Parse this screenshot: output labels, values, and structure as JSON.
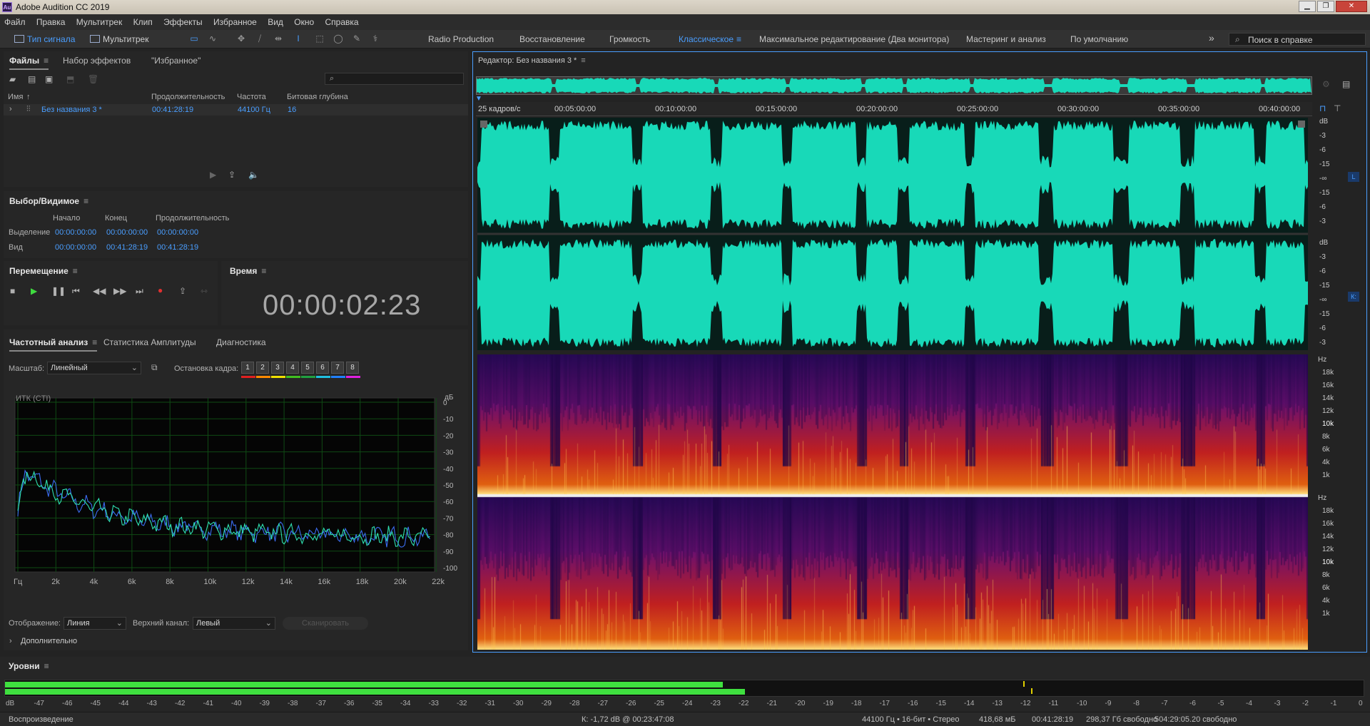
{
  "window": {
    "title": "Adobe Audition CC 2019",
    "logo_text": "Au"
  },
  "menu": [
    "Файл",
    "Правка",
    "Мультитрек",
    "Клип",
    "Эффекты",
    "Избранное",
    "Вид",
    "Окно",
    "Справка"
  ],
  "modes": {
    "waveform": "Тип сигнала",
    "multitrack": "Мультитрек"
  },
  "workspaces": [
    "Radio Production",
    "Восстановление",
    "Громкость",
    "Классическое",
    "Максимальное редактирование (Два монитора)",
    "Мастеринг и анализ",
    "По умолчанию"
  ],
  "active_workspace": "Классическое",
  "help_search_placeholder": "Поиск в справке",
  "files_panel": {
    "tabs": [
      "Файлы",
      "Набор эффектов",
      "\"Избранное\""
    ],
    "columns": [
      "Имя",
      "Продолжительность",
      "Частота",
      "Битовая глубина"
    ],
    "rows": [
      {
        "name": "Без названия 3 *",
        "duration": "00:41:28:19",
        "rate": "44100 Гц",
        "depth": "16"
      }
    ]
  },
  "selection_panel": {
    "title": "Выбор/Видимое",
    "headers": [
      "Начало",
      "Конец",
      "Продолжительность"
    ],
    "rows": [
      {
        "label": "Выделение",
        "start": "00:00:00:00",
        "end": "00:00:00:00",
        "duration": "00:00:00:00"
      },
      {
        "label": "Вид",
        "start": "00:00:00:00",
        "end": "00:41:28:19",
        "duration": "00:41:28:19"
      }
    ]
  },
  "transport_panel": {
    "title": "Перемещение"
  },
  "time_panel": {
    "title": "Время",
    "time": "00:00:02:23"
  },
  "analysis_panel": {
    "tabs": [
      "Частотный анализ",
      "Статистика Амплитуды",
      "Диагностика"
    ],
    "scale_label": "Масштаб:",
    "scale_value": "Линейный",
    "freeze_label": "Остановка кадра:",
    "freeze_buttons": [
      "1",
      "2",
      "3",
      "4",
      "5",
      "6",
      "7",
      "8"
    ],
    "freeze_colors": [
      "#e02020",
      "#ff8a00",
      "#f0e000",
      "#40c020",
      "#20a040",
      "#20c0e0",
      "#2080ff",
      "#e020e0"
    ],
    "graph_title": "ИТК (CTI)",
    "db_unit": "дБ",
    "db_ticks": [
      "0",
      "-10",
      "-20",
      "-30",
      "-40",
      "-50",
      "-60",
      "-70",
      "-80",
      "-90",
      "-100"
    ],
    "hz_ticks": [
      "Гц",
      "2k",
      "4k",
      "6k",
      "8k",
      "10k",
      "12k",
      "14k",
      "16k",
      "18k",
      "20k",
      "22k"
    ],
    "display_label": "Отображение:",
    "display_value": "Линия",
    "top_channel_label": "Верхний канал:",
    "top_channel_value": "Левый",
    "scan_button": "Сканировать",
    "advanced": "Дополнительно"
  },
  "editor": {
    "title": "Редактор: Без названия 3 *",
    "fps_label": "25 кадров/с",
    "ruler": [
      "00:05:00:00",
      "00:10:00:00",
      "00:15:00:00",
      "00:20:00:00",
      "00:25:00:00",
      "00:30:00:00",
      "00:35:00:00",
      "00:40:00:00"
    ],
    "db_scale_top": [
      "dB",
      "-3",
      "-6",
      "-15",
      "-∞",
      "-15",
      "-6",
      "-3"
    ],
    "db_scale_bottom": [
      "dB",
      "-3",
      "-6",
      "-15",
      "-∞",
      "-15",
      "-6",
      "-3"
    ],
    "channel_left": "L",
    "channel_right": "К:",
    "hz_scale": [
      "Hz",
      "18k",
      "16k",
      "14k",
      "12k",
      "10k",
      "8k",
      "6k",
      "4k",
      "1k"
    ],
    "waveform_color": "#18d9b8"
  },
  "levels_panel": {
    "title": "Уровни",
    "scale": [
      "dB",
      "-47",
      "-46",
      "-45",
      "-44",
      "-43",
      "-42",
      "-41",
      "-40",
      "-39",
      "-38",
      "-37",
      "-36",
      "-35",
      "-34",
      "-33",
      "-32",
      "-31",
      "-30",
      "-29",
      "-28",
      "-27",
      "-26",
      "-25",
      "-24",
      "-23",
      "-22",
      "-21",
      "-20",
      "-19",
      "-18",
      "-17",
      "-16",
      "-15",
      "-14",
      "-13",
      "-12",
      "-11",
      "-10",
      "-9",
      "-8",
      "-7",
      "-6",
      "-5",
      "-4",
      "-3",
      "-2",
      "-1",
      "0"
    ],
    "meter_color": "#3fe03f"
  },
  "status": {
    "left": "Воспроизведение",
    "cursor": "К: -1,72 dB @ 00:23:47:08",
    "format": "44100 Гц • 16-бит • Стерео",
    "size": "418,68 мБ",
    "duration": "00:41:28:19",
    "free": "298,37 Гб свободно",
    "free_time": "504:29:05.20 свободно"
  }
}
